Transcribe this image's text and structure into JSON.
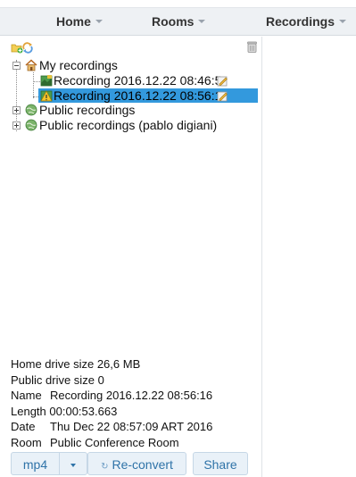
{
  "navbar": {
    "home_label": "Home",
    "rooms_label": "Rooms",
    "recordings_label": "Recordings"
  },
  "tree": {
    "root_my": "My recordings",
    "rec1": "Recording 2016.12.22 08:46:5",
    "rec2": "Recording 2016.12.22 08:56:1",
    "public": "Public recordings",
    "public_user": "Public recordings (pablo digiani)"
  },
  "info": {
    "home_drive_label": "Home drive size",
    "home_drive_value": "26,6 MB",
    "public_drive_label": "Public drive size",
    "public_drive_value": "0",
    "name_label": "Name",
    "name_value": "Recording 2016.12.22 08:56:16",
    "length_label": "Length",
    "length_value": "00:00:53.663",
    "date_label": "Date",
    "date_value": "Thu Dec 22 08:57:09 ART 2016",
    "room_label": "Room",
    "room_value": "Public Conference Room"
  },
  "actions": {
    "format_label": "mp4",
    "reconvert_label": "Re-convert",
    "share_label": "Share"
  },
  "colors": {
    "selection": "#3399dd",
    "button_text": "#2f73a8",
    "navbar_bg": "#eef1f4"
  }
}
